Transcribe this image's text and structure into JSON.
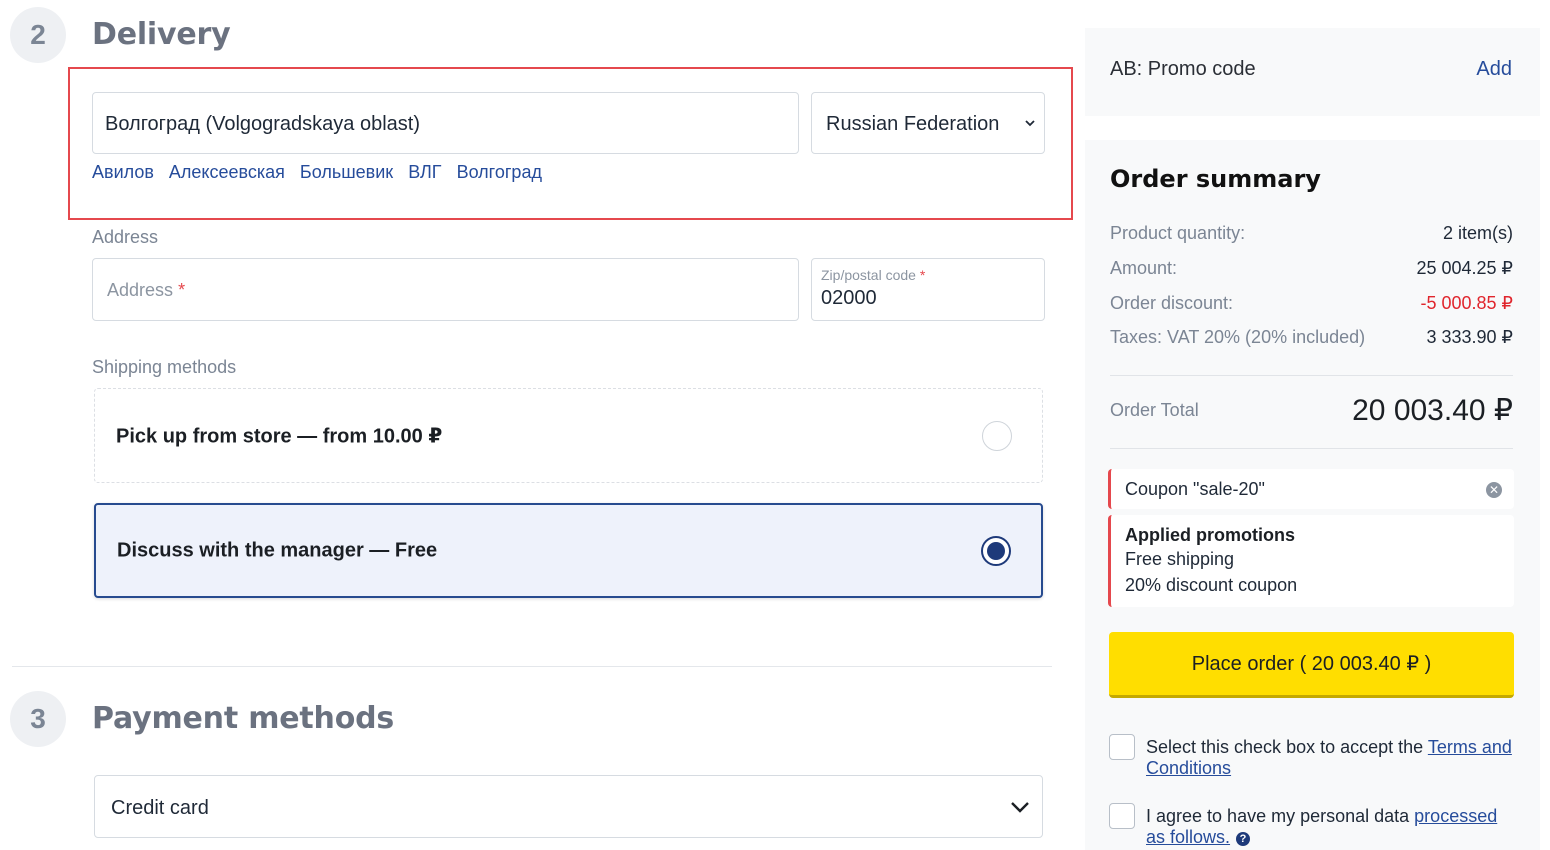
{
  "delivery": {
    "step_number": "2",
    "title": "Delivery",
    "city_value": "Волгоград (Volgogradskaya oblast)",
    "country_value": "Russian Federation",
    "city_suggestions": [
      "Авилов",
      "Алексеевская",
      "Большевик",
      "ВЛГ",
      "Волгоград"
    ],
    "address_section_label": "Address",
    "address_placeholder": "Address",
    "zip_label": "Zip/postal code",
    "zip_value": "02000",
    "required_mark": "*",
    "shipping_label": "Shipping methods",
    "shipping_methods": [
      {
        "label": "Pick up from store — from 10.00 ₽",
        "selected": false
      },
      {
        "label": "Discuss with the manager — Free",
        "selected": true
      }
    ]
  },
  "payment": {
    "step_number": "3",
    "title": "Payment methods",
    "selected_method": "Credit card"
  },
  "sidebar": {
    "promo_label": "AB: Promo code",
    "promo_add": "Add",
    "summary_title": "Order summary",
    "rows": [
      {
        "key": "Product quantity:",
        "value": "2 item(s)"
      },
      {
        "key": "Amount:",
        "value": "25 004.25 ₽"
      },
      {
        "key": "Order discount:",
        "value": "-5 000.85 ₽"
      },
      {
        "key": "Taxes: VAT 20% (20% included)",
        "value": "3 333.90 ₽"
      }
    ],
    "total_label": "Order Total",
    "total_value": "20 003.40 ₽",
    "coupon_text": "Coupon \"sale-20\"",
    "promotions_title": "Applied promotions",
    "promotions": [
      "Free shipping",
      "20% discount coupon"
    ],
    "place_order_label": "Place order ( 20 003.40 ₽ )",
    "terms_text": "Select this check box to accept the ",
    "terms_link": "Terms and Conditions",
    "personal_text": "I agree to have my personal data ",
    "personal_link": "processed as follows.",
    "help_glyph": "?"
  },
  "colors": {
    "accent_link": "#264c9b",
    "selected_border": "#274b8f",
    "button_yellow": "#ffde00",
    "error_red": "#e5484d",
    "discount_red": "#e0262d"
  }
}
